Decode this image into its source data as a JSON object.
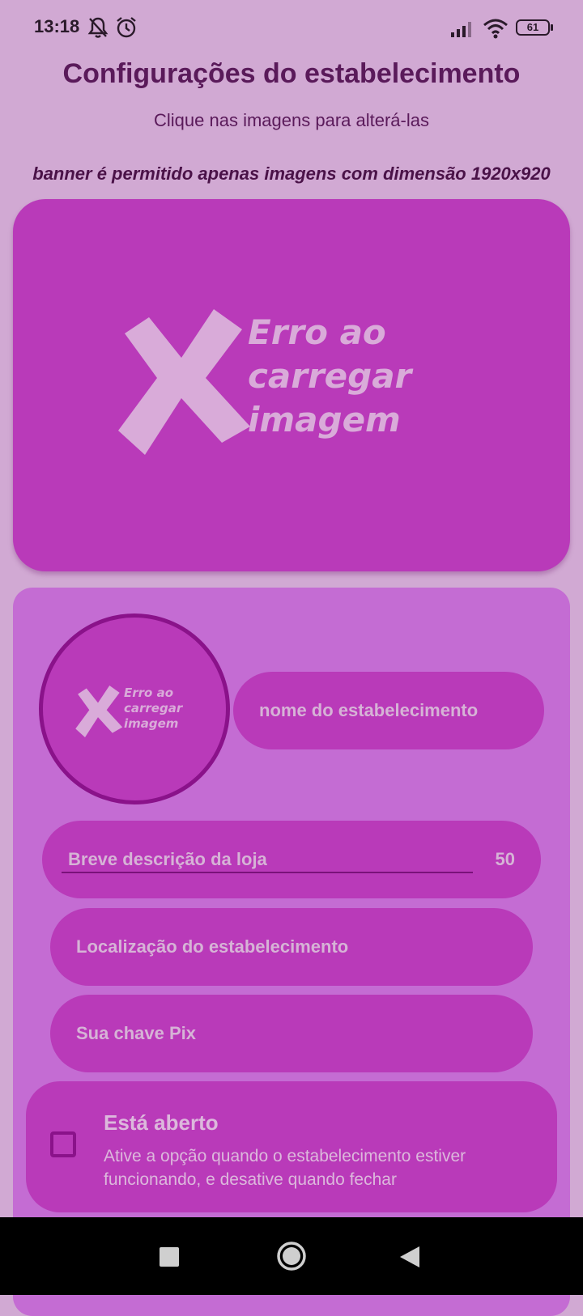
{
  "status_bar": {
    "time": "13:18",
    "battery": "61",
    "icons": [
      "bell-off-icon",
      "alarm-icon",
      "signal-icon",
      "wifi-icon",
      "battery-icon"
    ]
  },
  "header": {
    "title": "Configurações do estabelecimento",
    "subtitle": "Clique nas imagens para alterá-las",
    "banner_note": "banner é permitido apenas imagens com dimensão 1920x920"
  },
  "banner": {
    "error_line1": "Erro ao",
    "error_line2": "carregar",
    "error_line3": "imagem"
  },
  "profile": {
    "error_line1": "Erro ao",
    "error_line2": "carregar",
    "error_line3": "imagem",
    "name_placeholder": "nome do estabelecimento"
  },
  "form": {
    "description_placeholder": "Breve descrição da loja",
    "description_counter": "50",
    "location_placeholder": "Localização do estabelecimento",
    "pix_placeholder": "Sua chave Pix"
  },
  "open_toggle": {
    "title": "Está aberto",
    "description": "Ative a opção quando o estabelecimento estiver funcionando, e desative quando fechar",
    "checked": false
  },
  "colors": {
    "background": "#d1a9d3",
    "card": "#c46cd3",
    "accent": "#b93ab9",
    "border": "#8a128a",
    "title": "#5a1a5a"
  }
}
